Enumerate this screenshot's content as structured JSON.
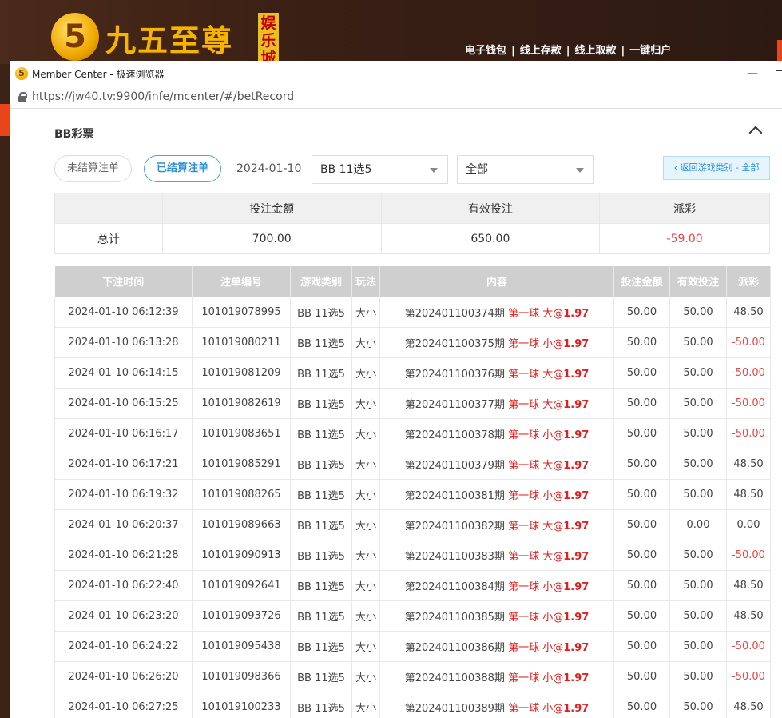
{
  "site": {
    "logo_glyph": "5",
    "logo_text": "九五至尊",
    "logo_badge": "娱乐城",
    "nav": [
      "电子钱包",
      "线上存款",
      "线上取款",
      "一键归户"
    ],
    "nav_sep": "|"
  },
  "window": {
    "title": "Member Center - 极速浏览器",
    "url": "https://jw40.tv:9900/infe/mcenter/#/betRecord",
    "min_glyph": "—"
  },
  "section": {
    "title": "BB彩票",
    "btn_unsettled": "未结算注单",
    "btn_settled": "已结算注单",
    "date": "2024-01-10",
    "game_select": "BB 11选5",
    "type_select": "全部",
    "btn_back": "‹ 返回游戏类别 - 全部"
  },
  "summary": {
    "headers": [
      "",
      "投注金额",
      "有效投注",
      "派彩"
    ],
    "row_label": "总计",
    "bet_amount": "700.00",
    "valid_bet": "650.00",
    "payout": "-59.00"
  },
  "colors": {
    "negative": "#e54545",
    "accent": "#2b8fd6",
    "odds": "#e02020"
  },
  "records": {
    "headers": [
      "下注时间",
      "注单编号",
      "游戏类别",
      "玩法",
      "内容",
      "投注金额",
      "有效投注",
      "派彩"
    ],
    "rows": [
      {
        "time": "2024-01-10 06:12:39",
        "id": "101019078995",
        "game": "BB 11选5",
        "play": "大小",
        "period": "第202401100374期",
        "pick": "第一球 大@",
        "odds": "1.97",
        "bet": "50.00",
        "valid": "50.00",
        "payout": "48.50",
        "neg": false
      },
      {
        "time": "2024-01-10 06:13:28",
        "id": "101019080211",
        "game": "BB 11选5",
        "play": "大小",
        "period": "第202401100375期",
        "pick": "第一球 小@",
        "odds": "1.97",
        "bet": "50.00",
        "valid": "50.00",
        "payout": "-50.00",
        "neg": true
      },
      {
        "time": "2024-01-10 06:14:15",
        "id": "101019081209",
        "game": "BB 11选5",
        "play": "大小",
        "period": "第202401100376期",
        "pick": "第一球 大@",
        "odds": "1.97",
        "bet": "50.00",
        "valid": "50.00",
        "payout": "-50.00",
        "neg": true
      },
      {
        "time": "2024-01-10 06:15:25",
        "id": "101019082619",
        "game": "BB 11选5",
        "play": "大小",
        "period": "第202401100377期",
        "pick": "第一球 大@",
        "odds": "1.97",
        "bet": "50.00",
        "valid": "50.00",
        "payout": "-50.00",
        "neg": true
      },
      {
        "time": "2024-01-10 06:16:17",
        "id": "101019083651",
        "game": "BB 11选5",
        "play": "大小",
        "period": "第202401100378期",
        "pick": "第一球 小@",
        "odds": "1.97",
        "bet": "50.00",
        "valid": "50.00",
        "payout": "-50.00",
        "neg": true
      },
      {
        "time": "2024-01-10 06:17:21",
        "id": "101019085291",
        "game": "BB 11选5",
        "play": "大小",
        "period": "第202401100379期",
        "pick": "第一球 大@",
        "odds": "1.97",
        "bet": "50.00",
        "valid": "50.00",
        "payout": "48.50",
        "neg": false
      },
      {
        "time": "2024-01-10 06:19:32",
        "id": "101019088265",
        "game": "BB 11选5",
        "play": "大小",
        "period": "第202401100381期",
        "pick": "第一球 小@",
        "odds": "1.97",
        "bet": "50.00",
        "valid": "50.00",
        "payout": "48.50",
        "neg": false
      },
      {
        "time": "2024-01-10 06:20:37",
        "id": "101019089663",
        "game": "BB 11选5",
        "play": "大小",
        "period": "第202401100382期",
        "pick": "第一球 大@",
        "odds": "1.97",
        "bet": "50.00",
        "valid": "0.00",
        "payout": "0.00",
        "neg": false
      },
      {
        "time": "2024-01-10 06:21:28",
        "id": "101019090913",
        "game": "BB 11选5",
        "play": "大小",
        "period": "第202401100383期",
        "pick": "第一球 大@",
        "odds": "1.97",
        "bet": "50.00",
        "valid": "50.00",
        "payout": "-50.00",
        "neg": true
      },
      {
        "time": "2024-01-10 06:22:40",
        "id": "101019092641",
        "game": "BB 11选5",
        "play": "大小",
        "period": "第202401100384期",
        "pick": "第一球 小@",
        "odds": "1.97",
        "bet": "50.00",
        "valid": "50.00",
        "payout": "48.50",
        "neg": false
      },
      {
        "time": "2024-01-10 06:23:20",
        "id": "101019093726",
        "game": "BB 11选5",
        "play": "大小",
        "period": "第202401100385期",
        "pick": "第一球 小@",
        "odds": "1.97",
        "bet": "50.00",
        "valid": "50.00",
        "payout": "48.50",
        "neg": false
      },
      {
        "time": "2024-01-10 06:24:22",
        "id": "101019095438",
        "game": "BB 11选5",
        "play": "大小",
        "period": "第202401100386期",
        "pick": "第一球 小@",
        "odds": "1.97",
        "bet": "50.00",
        "valid": "50.00",
        "payout": "-50.00",
        "neg": true
      },
      {
        "time": "2024-01-10 06:26:20",
        "id": "101019098366",
        "game": "BB 11选5",
        "play": "大小",
        "period": "第202401100388期",
        "pick": "第一球 小@",
        "odds": "1.97",
        "bet": "50.00",
        "valid": "50.00",
        "payout": "-50.00",
        "neg": true
      },
      {
        "time": "2024-01-10 06:27:25",
        "id": "101019100233",
        "game": "BB 11选5",
        "play": "大小",
        "period": "第202401100389期",
        "pick": "第一球 小@",
        "odds": "1.97",
        "bet": "50.00",
        "valid": "50.00",
        "payout": "48.50",
        "neg": false
      }
    ]
  }
}
